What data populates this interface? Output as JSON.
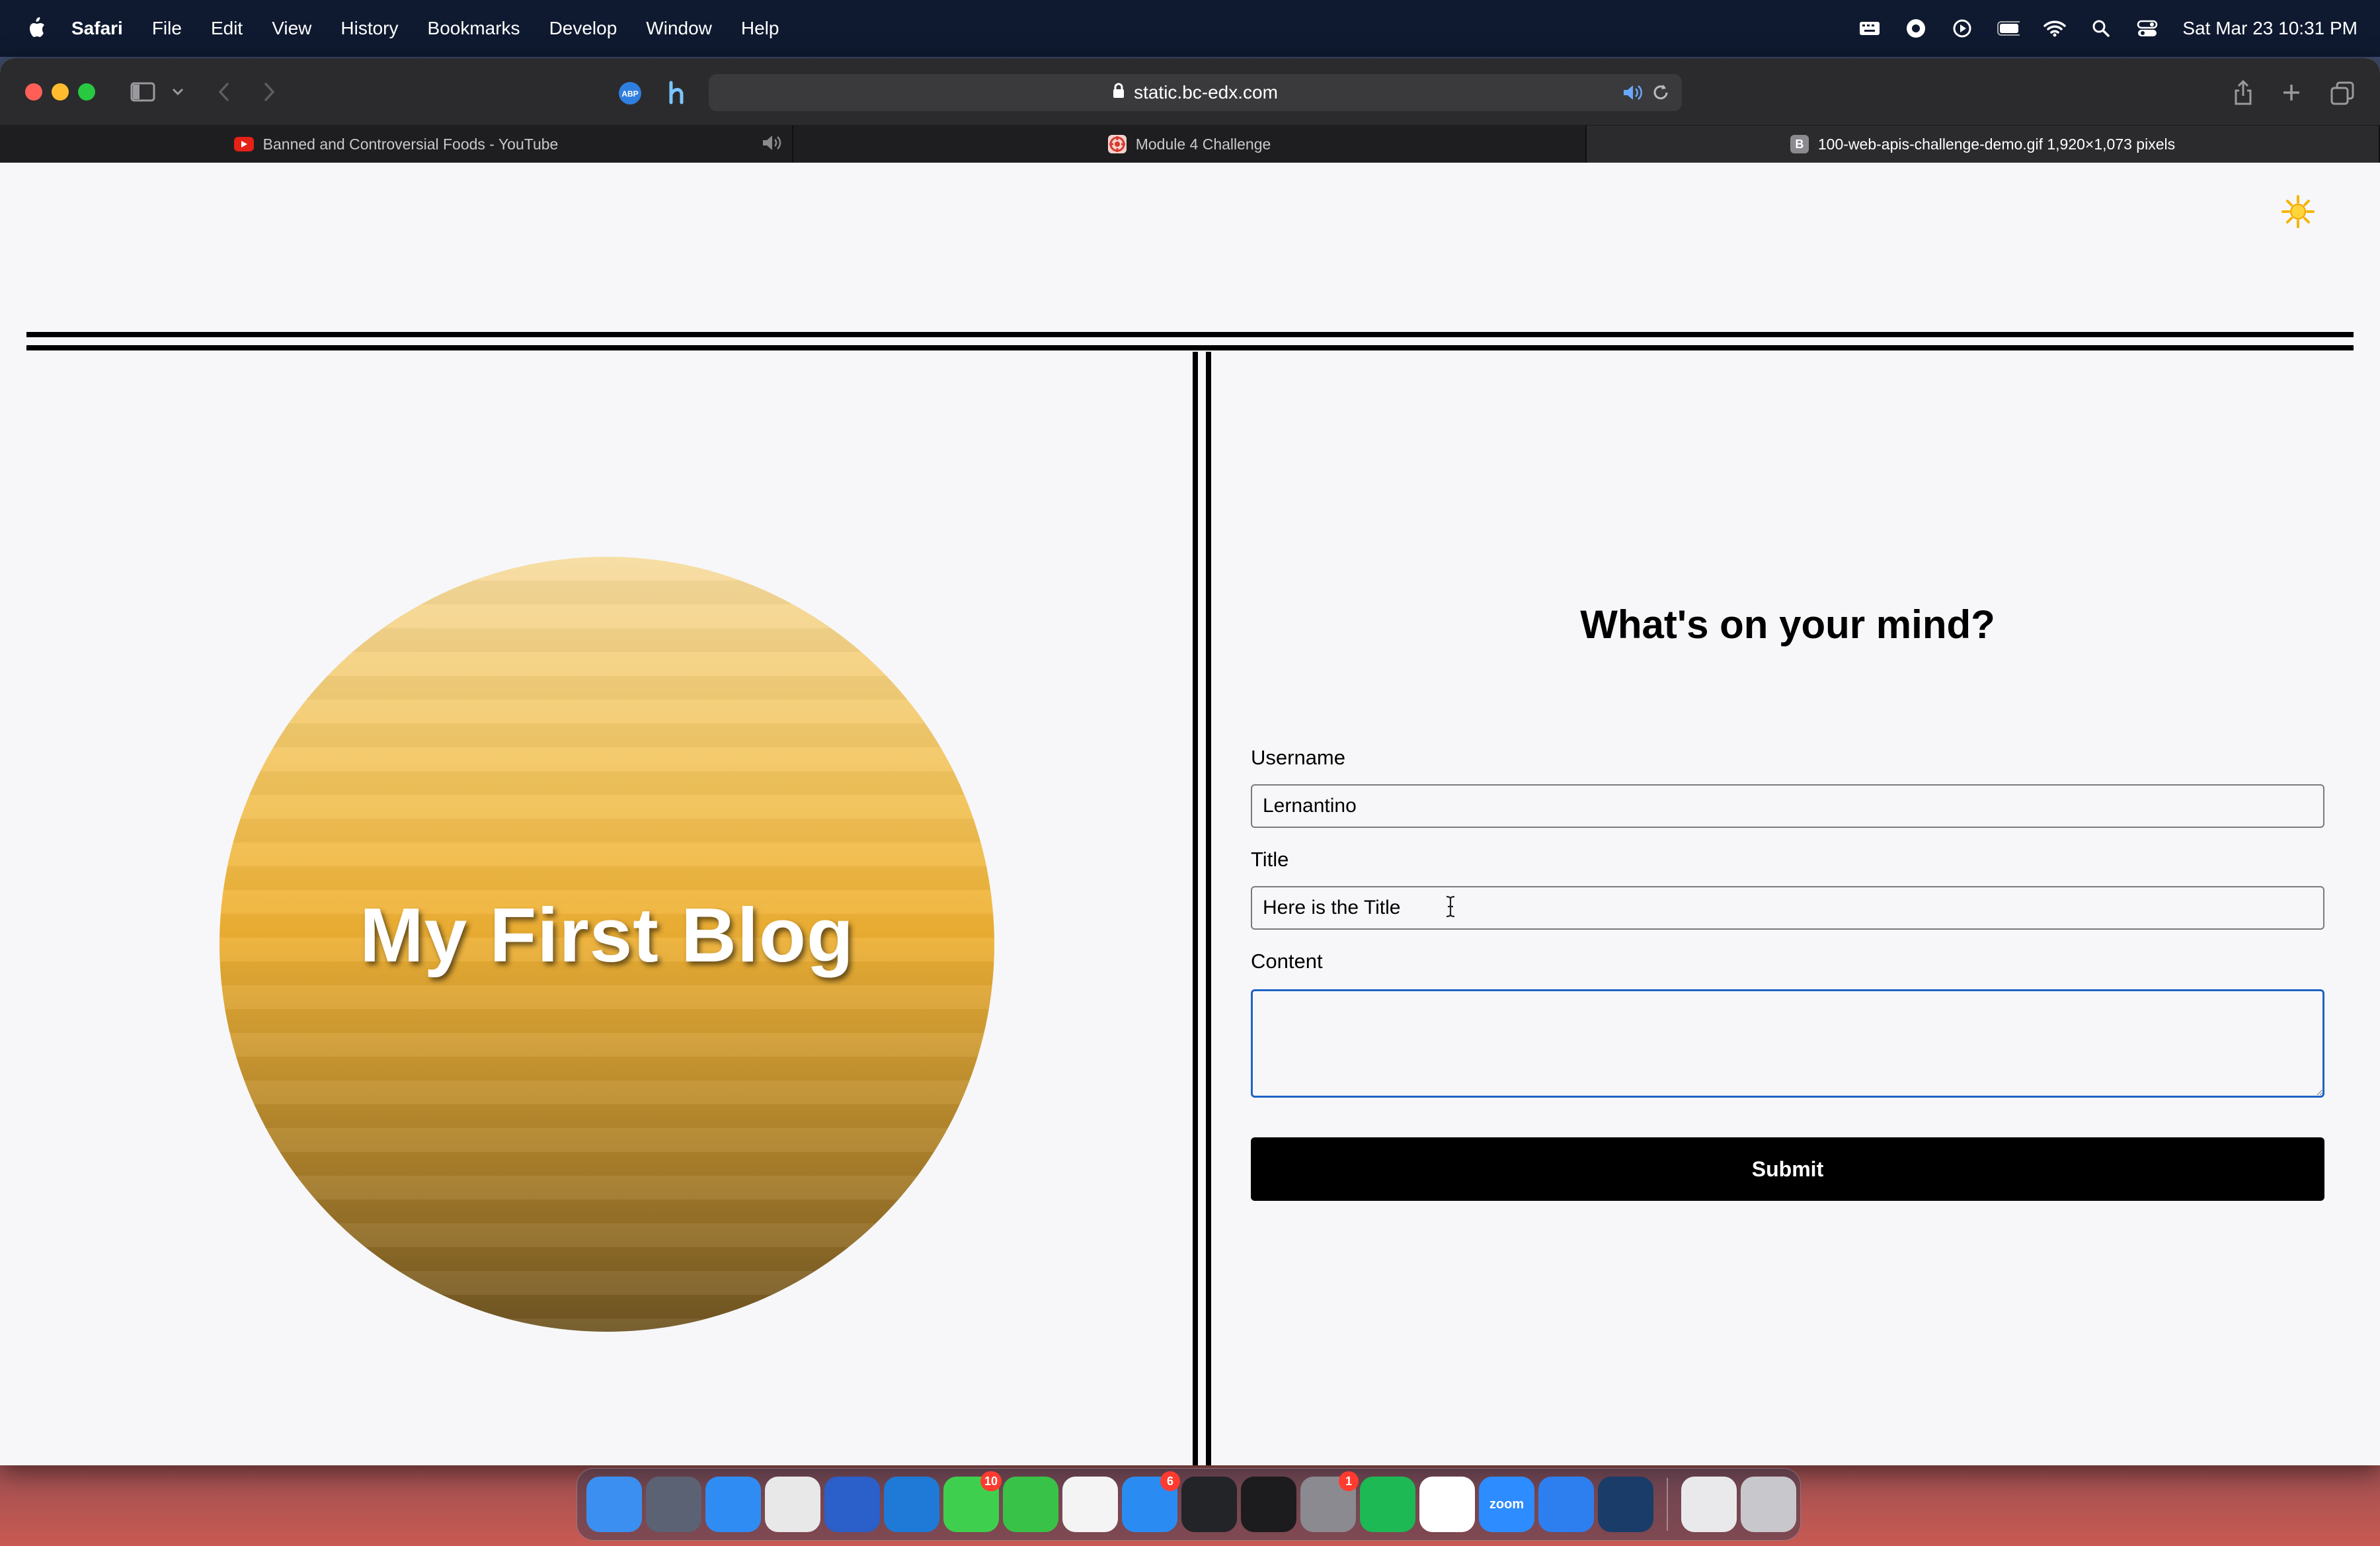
{
  "menubar": {
    "app_name": "Safari",
    "items": [
      "File",
      "Edit",
      "View",
      "History",
      "Bookmarks",
      "Develop",
      "Window",
      "Help"
    ],
    "datetime": "Sat Mar 23  10:31 PM"
  },
  "browser": {
    "url": "static.bc-edx.com",
    "tabs": [
      {
        "label": "Banned and Controversial Foods - YouTube",
        "favicon": "youtube-icon",
        "audio": true
      },
      {
        "label": "Module 4 Challenge",
        "favicon": "grid-favicon",
        "audio": false
      },
      {
        "label": "100-web-apis-challenge-demo.gif 1,920×1,073 pixels",
        "favicon": "b-favicon",
        "favicon_letter": "B",
        "audio": false
      }
    ]
  },
  "page": {
    "blog_title": "My First Blog",
    "form": {
      "heading": "What's on your mind?",
      "username_label": "Username",
      "username_value": "Lernantino",
      "title_label": "Title",
      "title_value": "Here is the Title",
      "content_label": "Content",
      "content_value": "",
      "submit_label": "Submit"
    }
  },
  "dock": {
    "apps": [
      {
        "name": "finder",
        "color": "#3b8ff0"
      },
      {
        "name": "launchpad",
        "color": "#5b6274"
      },
      {
        "name": "safari",
        "color": "#2f8cf3"
      },
      {
        "name": "chrome",
        "color": "#e8e8e8"
      },
      {
        "name": "firefox",
        "color": "#2b5fc9"
      },
      {
        "name": "vscode",
        "color": "#1e7ad6"
      },
      {
        "name": "messages",
        "color": "#3ecf4f",
        "badge": "10"
      },
      {
        "name": "facetime",
        "color": "#39c248"
      },
      {
        "name": "photos",
        "color": "#f4f4f4"
      },
      {
        "name": "app-store",
        "color": "#2a8cf2",
        "badge": "6"
      },
      {
        "name": "activity-monitor",
        "color": "#222428"
      },
      {
        "name": "terminal",
        "color": "#1c1c1e"
      },
      {
        "name": "system-settings",
        "color": "#8a8a90",
        "badge": "1"
      },
      {
        "name": "spotify",
        "color": "#1db954"
      },
      {
        "name": "slack",
        "color": "#ffffff"
      },
      {
        "name": "zoom",
        "color": "#2d8cff",
        "label": "zoom"
      },
      {
        "name": "edge-ish",
        "color": "#2d7ff0"
      },
      {
        "name": "steam",
        "color": "#1a3c68"
      }
    ],
    "trailing": [
      {
        "name": "documents",
        "color": "#e9e9ec"
      },
      {
        "name": "trash",
        "color": "#c8c8cc"
      }
    ]
  }
}
